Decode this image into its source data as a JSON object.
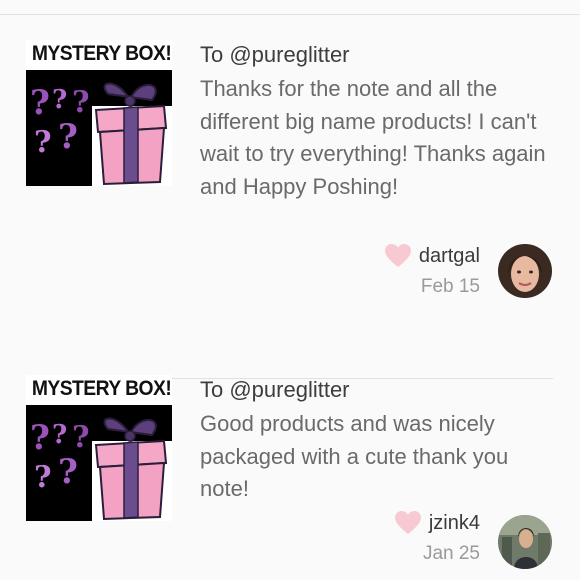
{
  "reviews": [
    {
      "thumb_title": "MYSTERY BOX!",
      "to": "To @pureglitter",
      "body": "Thanks for the note and all the different big name products! I can't wait to try everything! Thanks again and Happy Poshing!",
      "author": "dartgal",
      "date": "Feb 15"
    },
    {
      "thumb_title": "MYSTERY BOX!",
      "to": "To @pureglitter",
      "body": "Good products and was nicely packaged with a cute thank you note!",
      "author": "jzink4",
      "date": "Jan 25"
    }
  ],
  "icons": {
    "like": "heart-icon",
    "question": "question-mark-icon",
    "gift": "gift-box-icon"
  },
  "colors": {
    "heart": "#f7c9d2",
    "gift_pink": "#f4a7c6",
    "ribbon_purple": "#6b4c8f",
    "question_purple": "#a75ec4"
  }
}
